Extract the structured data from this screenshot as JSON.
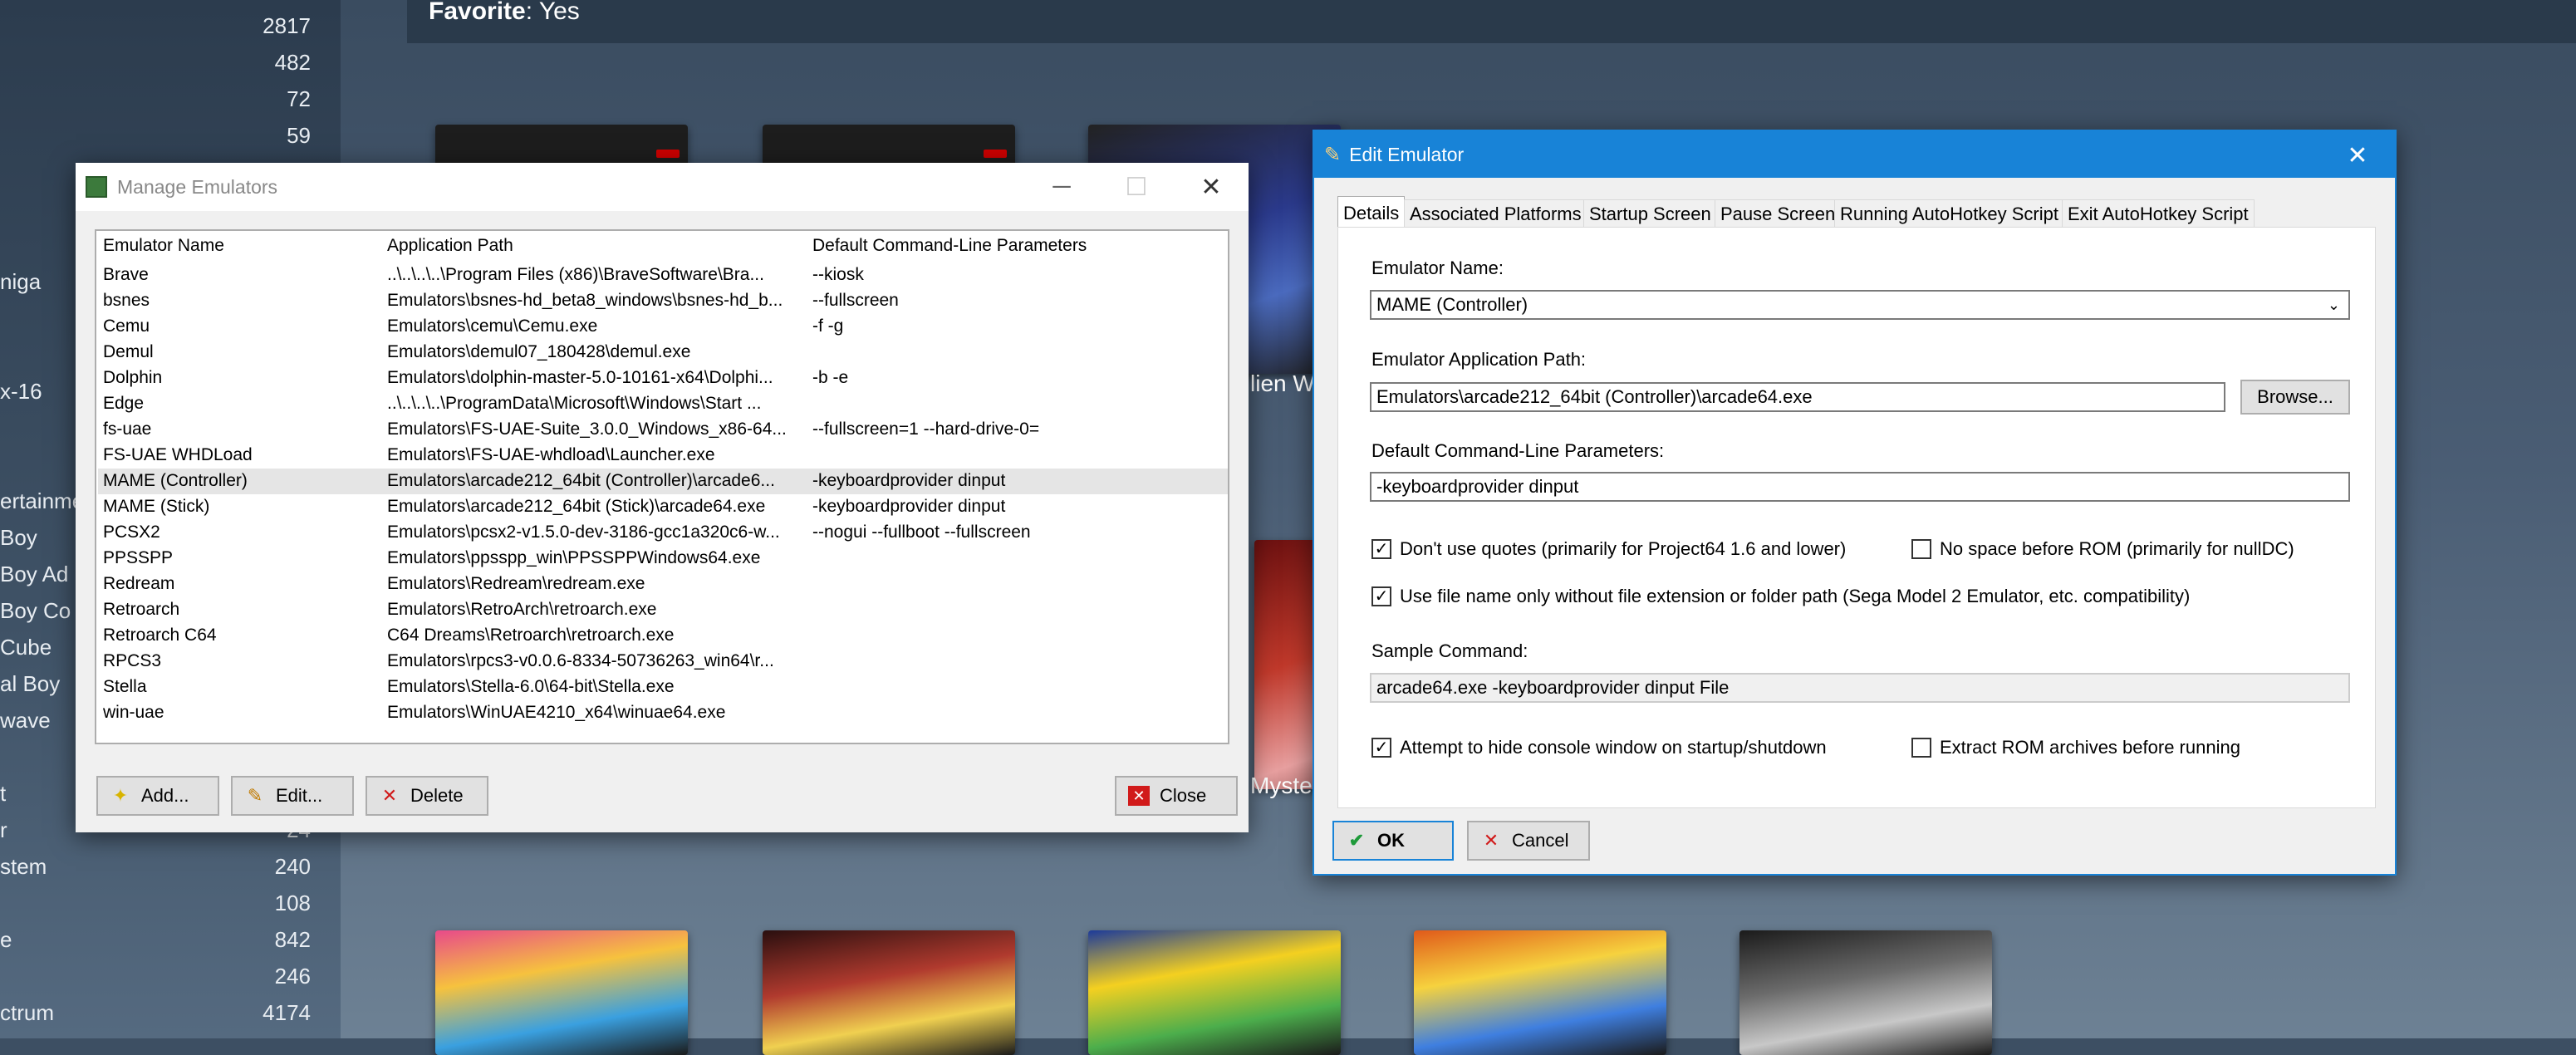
{
  "background": {
    "left_counts": [
      "2817",
      "482",
      "72",
      "59",
      "240",
      "108",
      "842",
      "246",
      "4174"
    ],
    "left_labels_partial": [
      "niga",
      "x-16",
      "ertainmen",
      "Boy",
      "Boy Ad",
      "Boy Co",
      "Cube",
      "al Boy",
      "wave",
      "t",
      "r",
      "stem",
      "e",
      "ctrum"
    ],
    "count_partial": "24",
    "favorite_label": "Favorite",
    "favorite_value": ": Yes",
    "peek_text_1": "lien Wa",
    "peek_text_2": "Myster"
  },
  "manage": {
    "title": "Manage Emulators",
    "columns": [
      "Emulator Name",
      "Application Path",
      "Default Command-Line Parameters"
    ],
    "rows": [
      {
        "name": "Brave",
        "path": "..\\..\\..\\..\\Program Files (x86)\\BraveSoftware\\Bra...",
        "params": "--kiosk"
      },
      {
        "name": "bsnes",
        "path": "Emulators\\bsnes-hd_beta8_windows\\bsnes-hd_b...",
        "params": "--fullscreen"
      },
      {
        "name": "Cemu",
        "path": "Emulators\\cemu\\Cemu.exe",
        "params": "-f -g"
      },
      {
        "name": "Demul",
        "path": "Emulators\\demul07_180428\\demul.exe",
        "params": ""
      },
      {
        "name": "Dolphin",
        "path": "Emulators\\dolphin-master-5.0-10161-x64\\Dolphi...",
        "params": "-b -e"
      },
      {
        "name": "Edge",
        "path": "..\\..\\..\\..\\ProgramData\\Microsoft\\Windows\\Start ...",
        "params": ""
      },
      {
        "name": "fs-uae",
        "path": "Emulators\\FS-UAE-Suite_3.0.0_Windows_x86-64...",
        "params": "--fullscreen=1 --hard-drive-0="
      },
      {
        "name": "FS-UAE WHDLoad",
        "path": "Emulators\\FS-UAE-whdload\\Launcher.exe",
        "params": ""
      },
      {
        "name": "MAME (Controller)",
        "path": "Emulators\\arcade212_64bit (Controller)\\arcade6...",
        "params": "-keyboardprovider dinput"
      },
      {
        "name": "MAME (Stick)",
        "path": "Emulators\\arcade212_64bit (Stick)\\arcade64.exe",
        "params": "-keyboardprovider dinput"
      },
      {
        "name": "PCSX2",
        "path": "Emulators\\pcsx2-v1.5.0-dev-3186-gcc1a320c6-w...",
        "params": "--nogui --fullboot --fullscreen"
      },
      {
        "name": "PPSSPP",
        "path": "Emulators\\ppsspp_win\\PPSSPPWindows64.exe",
        "params": ""
      },
      {
        "name": "Redream",
        "path": "Emulators\\Redream\\redream.exe",
        "params": ""
      },
      {
        "name": "Retroarch",
        "path": "Emulators\\RetroArch\\retroarch.exe",
        "params": ""
      },
      {
        "name": "Retroarch C64",
        "path": "C64 Dreams\\Retroarch\\retroarch.exe",
        "params": ""
      },
      {
        "name": "RPCS3",
        "path": "Emulators\\rpcs3-v0.0.6-8334-50736263_win64\\r...",
        "params": ""
      },
      {
        "name": "Stella",
        "path": "Emulators\\Stella-6.0\\64-bit\\Stella.exe",
        "params": ""
      },
      {
        "name": "win-uae",
        "path": "Emulators\\WinUAE4210_x64\\winuae64.exe",
        "params": ""
      }
    ],
    "selected_row": 8,
    "add_label": "Add...",
    "edit_label": "Edit...",
    "delete_label": "Delete",
    "close_label": "Close"
  },
  "edit": {
    "title": "Edit Emulator",
    "tabs": [
      "Details",
      "Associated Platforms",
      "Startup Screen",
      "Pause Screen",
      "Running AutoHotkey Script",
      "Exit AutoHotkey Script"
    ],
    "active_tab": 0,
    "name_label": "Emulator Name:",
    "name_value": "MAME (Controller)",
    "path_label": "Emulator Application Path:",
    "path_value": "Emulators\\arcade212_64bit (Controller)\\arcade64.exe",
    "browse_label": "Browse...",
    "params_label": "Default Command-Line Parameters:",
    "params_value": "-keyboardprovider dinput",
    "opt_quotes": {
      "label": "Don't use quotes (primarily for Project64 1.6 and lower)",
      "checked": true
    },
    "opt_nospace": {
      "label": "No space before ROM (primarily for nullDC)",
      "checked": false
    },
    "opt_filename": {
      "label": "Use file name only without file extension or folder path (Sega Model 2 Emulator, etc. compatibility)",
      "checked": true
    },
    "sample_label": "Sample Command:",
    "sample_value": "arcade64.exe -keyboardprovider dinput File",
    "opt_hide": {
      "label": "Attempt to hide console window on startup/shutdown",
      "checked": true
    },
    "opt_extract": {
      "label": "Extract ROM archives before running",
      "checked": false
    },
    "ok_label": "OK",
    "cancel_label": "Cancel"
  },
  "icons": {
    "app_icon": "emulator-chip-icon",
    "edit_title_icon": "pencil-icon",
    "add_icon": "star-icon",
    "edit_icon": "pencil-icon",
    "delete_icon": "x-icon",
    "close_icon": "close-x-icon",
    "ok_icon": "checkmark-icon",
    "cancel_icon": "x-icon"
  },
  "colors": {
    "accent": "#1883d7",
    "danger": "#d11a1a",
    "ok": "#1e9a3a",
    "selection": "#e5e5e5"
  }
}
